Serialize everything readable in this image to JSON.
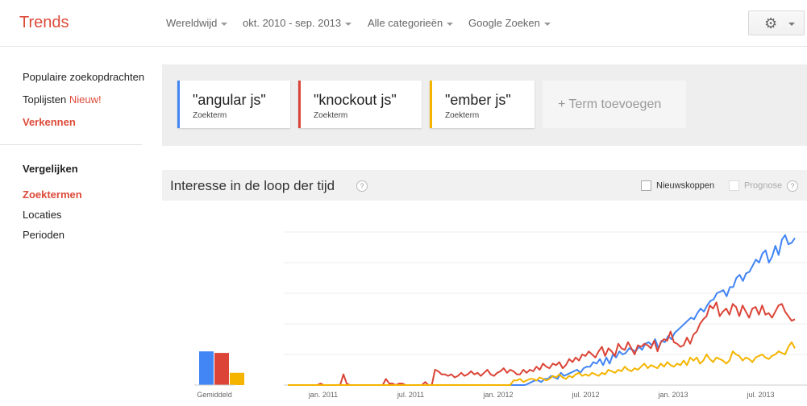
{
  "header": {
    "logo": "Trends",
    "filters": [
      {
        "label": "Wereldwijd"
      },
      {
        "label": "okt. 2010 - sep. 2013"
      },
      {
        "label": "Alle categorieën"
      },
      {
        "label": "Google Zoeken"
      }
    ],
    "settings_icon": "gear-icon"
  },
  "sidebar": {
    "popular": "Populaire zoekopdrachten",
    "toplists": "Toplijsten",
    "new_badge": "Nieuw!",
    "explore": "Verkennen",
    "compare_heading": "Vergelijken",
    "compare_items": [
      {
        "label": "Zoektermen"
      },
      {
        "label": "Locaties"
      },
      {
        "label": "Perioden"
      }
    ]
  },
  "terms": {
    "items": [
      {
        "name": "\"angular js\"",
        "type": "Zoekterm",
        "color": "#4285f4"
      },
      {
        "name": "\"knockout js\"",
        "type": "Zoekterm",
        "color": "#db4437"
      },
      {
        "name": "\"ember js\"",
        "type": "Zoekterm",
        "color": "#f4b400"
      }
    ],
    "add_label": "+ Term toevoegen"
  },
  "chart_header": {
    "title": "Interesse in de loop der tijd",
    "help": "?",
    "news_label": "Nieuwskoppen",
    "forecast_label": "Prognose"
  },
  "chart_data": {
    "type": "line",
    "ylim": [
      0,
      100
    ],
    "grid": true,
    "x_tick_labels": [
      "jan. 2011",
      "jul. 2011",
      "jan. 2012",
      "jul. 2012",
      "jan. 2013",
      "jul. 2013"
    ],
    "average_label": "Gemiddeld",
    "averages": [
      {
        "series": "\"angular js\"",
        "value": 22,
        "color": "#4285f4"
      },
      {
        "series": "\"knockout js\"",
        "value": 21,
        "color": "#db4437"
      },
      {
        "series": "\"ember js\"",
        "value": 8,
        "color": "#f4b400"
      }
    ],
    "series": [
      {
        "name": "\"angular js\"",
        "color": "#4285f4",
        "values": [
          0,
          0,
          0,
          0,
          0,
          0,
          0,
          0,
          0,
          0,
          0,
          0,
          0,
          0,
          0,
          0,
          0,
          0,
          0,
          0,
          0,
          0,
          0,
          0,
          0,
          0,
          0,
          0,
          0,
          0,
          0,
          0,
          0,
          0,
          0,
          0,
          0,
          0,
          0,
          0,
          0,
          0,
          0,
          0,
          0,
          0,
          0,
          0,
          0,
          0,
          0,
          0,
          0,
          0,
          0,
          0,
          0,
          0,
          0,
          0,
          0,
          0,
          0,
          0,
          0,
          0,
          0,
          0,
          0,
          0,
          0,
          0,
          0,
          0,
          1,
          2,
          3,
          3,
          2,
          4,
          4,
          6,
          5,
          4,
          8,
          6,
          7,
          8,
          9,
          10,
          8,
          11,
          12,
          12,
          15,
          14,
          17,
          13,
          18,
          14,
          20,
          18,
          22,
          20,
          21,
          24,
          23,
          22,
          25,
          23,
          27,
          28,
          26,
          30,
          24,
          29,
          28,
          32,
          30,
          34,
          36,
          38,
          40,
          42,
          44,
          43,
          47,
          50,
          48,
          52,
          55,
          56,
          60,
          61,
          62,
          58,
          64,
          64,
          70,
          72,
          68,
          73,
          74,
          78,
          82,
          80,
          86,
          88,
          80,
          84,
          91,
          85,
          95,
          98,
          92,
          93,
          96
        ]
      },
      {
        "name": "\"knockout js\"",
        "color": "#db4437",
        "values": [
          0,
          0,
          0,
          0,
          0,
          0,
          0,
          0,
          0,
          0,
          1,
          0,
          0,
          0,
          0,
          0,
          0,
          7,
          1,
          0,
          0,
          0,
          0,
          0,
          0,
          0,
          0,
          0,
          0,
          0,
          4,
          1,
          1,
          0,
          1,
          1,
          0,
          0,
          0,
          0,
          0,
          0,
          2,
          0,
          0,
          10,
          9,
          7,
          7,
          6,
          7,
          5,
          6,
          8,
          6,
          7,
          9,
          7,
          8,
          6,
          8,
          10,
          7,
          6,
          8,
          9,
          11,
          8,
          10,
          9,
          7,
          7,
          10,
          8,
          10,
          9,
          12,
          10,
          14,
          12,
          11,
          14,
          13,
          15,
          11,
          13,
          17,
          15,
          18,
          16,
          20,
          19,
          22,
          20,
          18,
          22,
          25,
          19,
          24,
          22,
          19,
          27,
          24,
          23,
          28,
          24,
          20,
          26,
          25,
          27,
          26,
          24,
          29,
          22,
          28,
          30,
          29,
          35,
          28,
          27,
          25,
          26,
          31,
          27,
          33,
          35,
          40,
          43,
          45,
          52,
          50,
          54,
          45,
          48,
          50,
          46,
          53,
          51,
          45,
          52,
          48,
          44,
          50,
          51,
          46,
          52,
          46,
          47,
          44,
          48,
          52,
          53,
          48,
          45,
          42,
          43
        ]
      },
      {
        "name": "\"ember js\"",
        "color": "#f4b400",
        "values": [
          0,
          0,
          0,
          0,
          0,
          0,
          0,
          0,
          0,
          0,
          0,
          0,
          0,
          0,
          0,
          0,
          0,
          0,
          0,
          0,
          0,
          0,
          0,
          0,
          0,
          0,
          0,
          0,
          0,
          0,
          0,
          0,
          0,
          0,
          0,
          0,
          0,
          0,
          0,
          0,
          0,
          0,
          0,
          0,
          0,
          0,
          0,
          0,
          0,
          0,
          0,
          0,
          0,
          0,
          0,
          0,
          0,
          0,
          0,
          0,
          0,
          0,
          0,
          0,
          0,
          0,
          0,
          0,
          0,
          3,
          3,
          4,
          2,
          3,
          4,
          4,
          3,
          5,
          4,
          3,
          4,
          6,
          5,
          7,
          5,
          4,
          6,
          5,
          7,
          8,
          6,
          7,
          6,
          8,
          7,
          6,
          8,
          7,
          10,
          9,
          8,
          10,
          9,
          12,
          10,
          9,
          11,
          10,
          12,
          14,
          11,
          13,
          12,
          11,
          14,
          12,
          15,
          13,
          12,
          14,
          13,
          16,
          13,
          18,
          16,
          18,
          14,
          16,
          20,
          17,
          15,
          18,
          17,
          16,
          14,
          16,
          22,
          20,
          19,
          16,
          18,
          17,
          15,
          18,
          19,
          20,
          18,
          17,
          19,
          20,
          22,
          21,
          20,
          25,
          28,
          24
        ]
      }
    ]
  }
}
